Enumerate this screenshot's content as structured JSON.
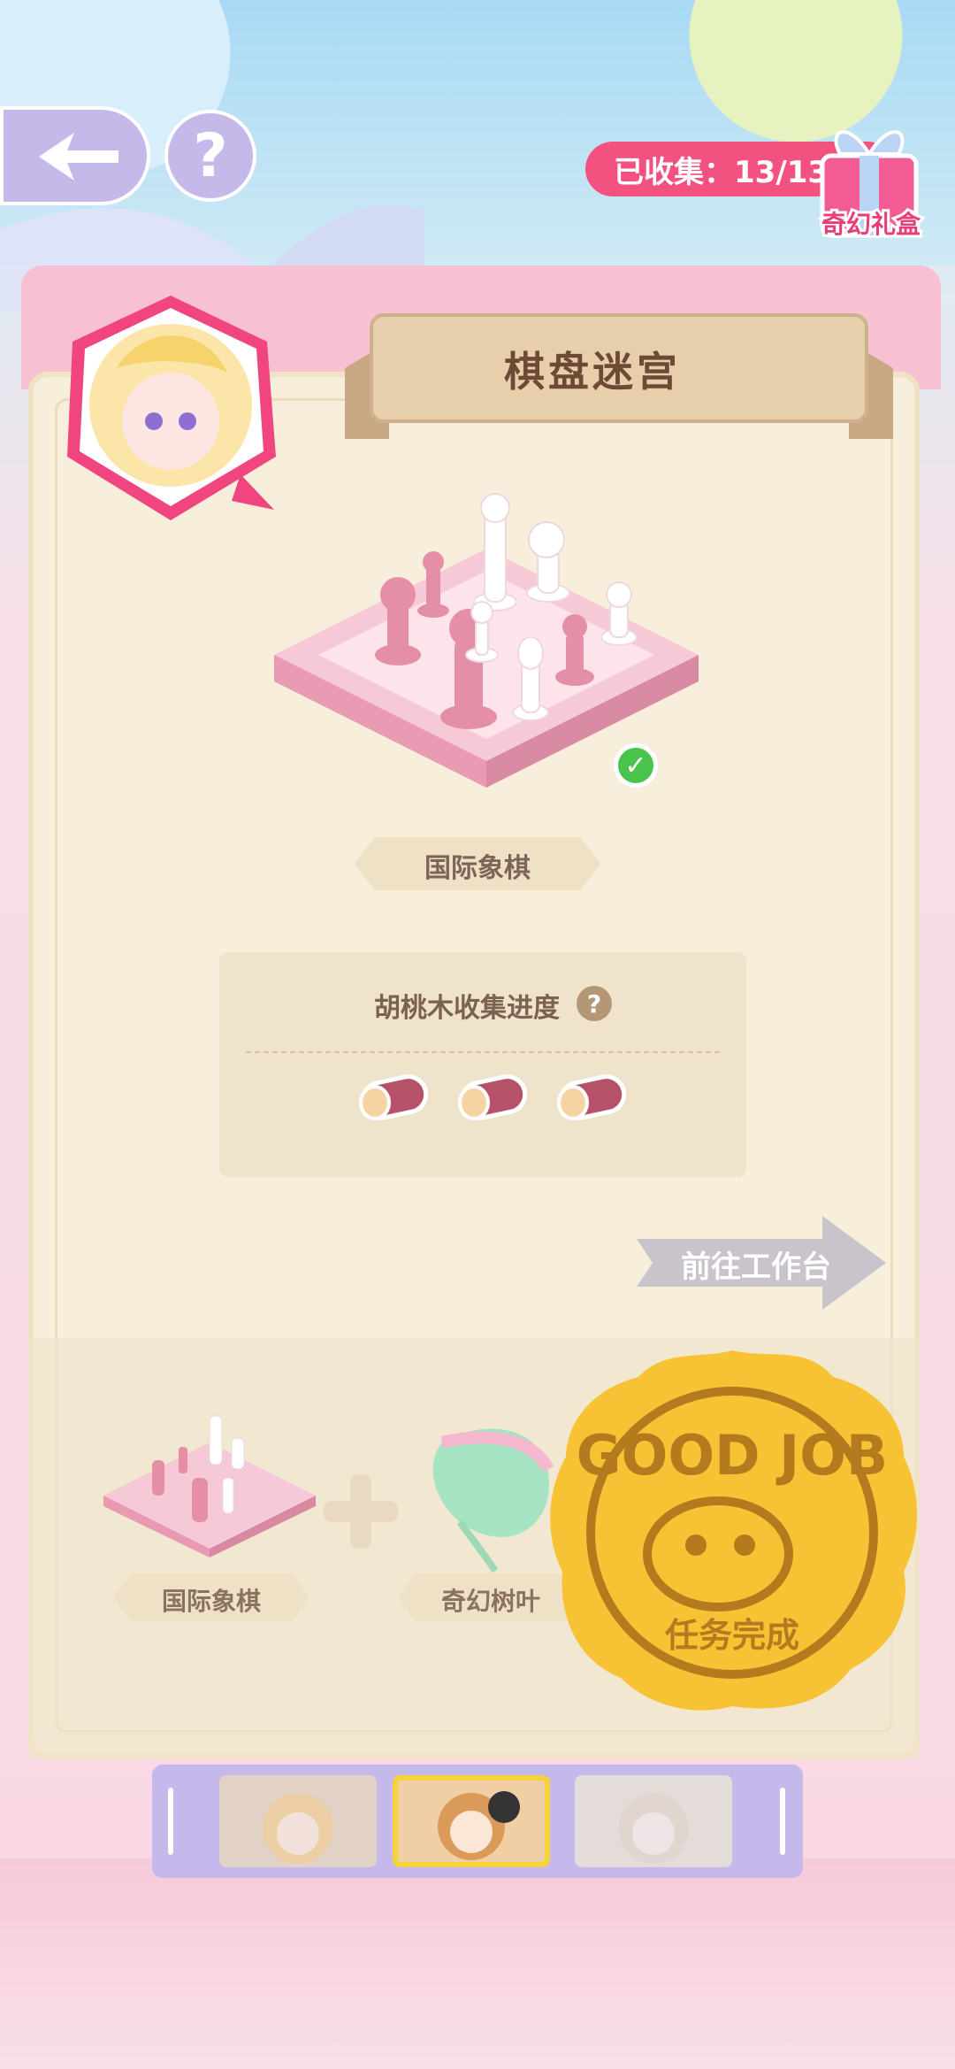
{
  "header": {
    "collected_label": "已收集：13/13",
    "gift_box_label": "奇幻礼盒"
  },
  "panel": {
    "title": "棋盘迷宫",
    "item_name": "国际象棋"
  },
  "progress": {
    "title": "胡桃木收集进度",
    "help_symbol": "?",
    "collected": 3,
    "total": 3
  },
  "actions": {
    "goto_workbench": "前往工作台"
  },
  "recipe": {
    "ingredients": [
      "国际象棋",
      "奇幻树叶"
    ]
  },
  "stamp": {
    "text_top": "GOOD JOB",
    "text_bottom": "任务完成"
  },
  "characters": {
    "count": 3,
    "active_index": 1
  },
  "colors": {
    "accent_pink": "#f3517f",
    "panel_pink": "#f3a9c4",
    "lavender": "#c5b9ea",
    "check_green": "#49c34a",
    "stamp_gold": "#f7c234"
  }
}
